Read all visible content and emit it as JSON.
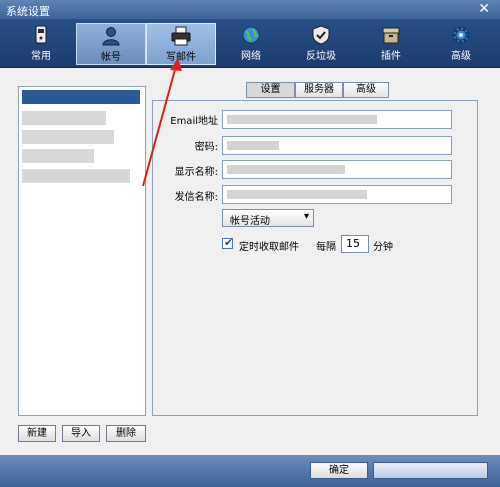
{
  "window": {
    "title": "系统设置",
    "close_glyph": "✕"
  },
  "toolbar": {
    "items": [
      {
        "label": "常用",
        "icon": "phone-icon"
      },
      {
        "label": "帐号",
        "icon": "person-icon"
      },
      {
        "label": "写邮件",
        "icon": "printer-icon"
      },
      {
        "label": "网络",
        "icon": "globe-icon"
      },
      {
        "label": "反垃圾",
        "icon": "shield-icon"
      },
      {
        "label": "插件",
        "icon": "box-icon"
      },
      {
        "label": "高级",
        "icon": "gear-icon"
      }
    ]
  },
  "tabs": [
    {
      "label": "设置"
    },
    {
      "label": "服务器"
    },
    {
      "label": "高级"
    }
  ],
  "form": {
    "email_label": "Email地址",
    "password_label": "密码:",
    "display_name_label": "显示名称:",
    "sender_name_label": "发信名称:",
    "account_status": "帐号活动",
    "auto_receive_label": "定时收取邮件",
    "interval_prefix": "每隔",
    "interval_value": "15",
    "interval_unit": "分钟"
  },
  "left_buttons": {
    "new": "新建",
    "import": "导入",
    "delete": "删除"
  },
  "footer": {
    "ok": "确定"
  },
  "colors": {
    "accent": "#2a5b94",
    "annotation_arrow": "#e0201a"
  }
}
